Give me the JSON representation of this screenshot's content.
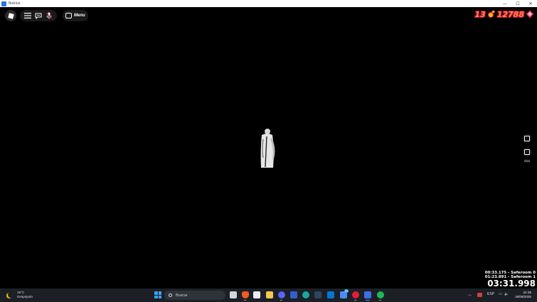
{
  "window": {
    "title": "Roblox",
    "minimize": "—",
    "maximize": "☐",
    "close": "✕"
  },
  "topbar": {
    "menu_label": "Menu"
  },
  "counters": {
    "left_value": "13",
    "right_value": "12788"
  },
  "timer": {
    "splits": [
      "00:33.175 - Saferoom 0",
      "01:23.891 - Saferoom 1"
    ],
    "main": "03:31.998"
  },
  "taskbar": {
    "weather_temp": "19°C",
    "weather_desc": "Despejado",
    "search_placeholder": "Buscar",
    "language": "ESP",
    "time": "22:35",
    "date": "18/09/2025",
    "notification_badge": "29"
  },
  "colors": {
    "counter_fill": "#ff8a3a",
    "counter_outline": "#c0103a",
    "taskbar_bg": "#1c1f26",
    "accent_blue": "#3aa0f0"
  }
}
